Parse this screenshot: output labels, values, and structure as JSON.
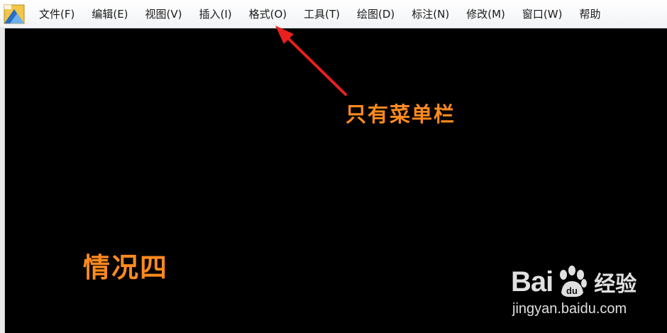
{
  "menubar": {
    "items": [
      {
        "label": "文件(F)"
      },
      {
        "label": "编辑(E)"
      },
      {
        "label": "视图(V)"
      },
      {
        "label": "插入(I)"
      },
      {
        "label": "格式(O)"
      },
      {
        "label": "工具(T)"
      },
      {
        "label": "绘图(D)"
      },
      {
        "label": "标注(N)"
      },
      {
        "label": "修改(M)"
      },
      {
        "label": "窗口(W)"
      },
      {
        "label": "帮助"
      }
    ]
  },
  "annotations": {
    "arrow_note": "只有菜单栏",
    "case_label": "情况四"
  },
  "watermark": {
    "brand_left": "Bai",
    "brand_right": "经验",
    "url": "jingyan.baidu.com"
  },
  "colors": {
    "canvas_background": "#000000",
    "annotation_orange": "#ff8a1e",
    "arrow_red": "#e8201e",
    "menubar_background": "#f5f6f8"
  },
  "icons": {
    "app_icon": "autocad-app-icon",
    "watermark_icon": "baidu-paw-icon"
  }
}
